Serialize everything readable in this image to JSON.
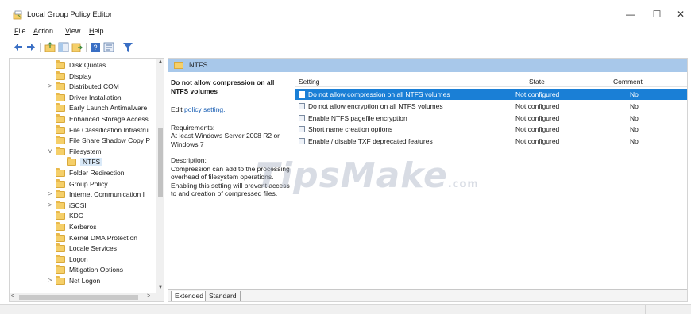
{
  "window": {
    "title": "Local Group Policy Editor",
    "controls": {
      "minimize": "—",
      "maximize": "☐",
      "close": "✕"
    }
  },
  "menu": [
    "File",
    "Action",
    "View",
    "Help"
  ],
  "toolbar": {
    "icons": [
      "back-arrow-icon",
      "forward-arrow-icon",
      "up-folder-icon",
      "show-hide-tree-icon",
      "export-list-icon",
      "help-icon",
      "properties-icon",
      "filter-icon"
    ]
  },
  "tree": {
    "items": [
      {
        "label": "Disk Quotas",
        "indent": 1,
        "expander": ""
      },
      {
        "label": "Display",
        "indent": 1,
        "expander": ""
      },
      {
        "label": "Distributed COM",
        "indent": 1,
        "expander": ">"
      },
      {
        "label": "Driver Installation",
        "indent": 1,
        "expander": ""
      },
      {
        "label": "Early Launch Antimalware",
        "indent": 1,
        "expander": ""
      },
      {
        "label": "Enhanced Storage Access",
        "indent": 1,
        "expander": ""
      },
      {
        "label": "File Classification Infrastru",
        "indent": 1,
        "expander": ""
      },
      {
        "label": "File Share Shadow Copy P",
        "indent": 1,
        "expander": ""
      },
      {
        "label": "Filesystem",
        "indent": 1,
        "expander": "v"
      },
      {
        "label": "NTFS",
        "indent": 2,
        "expander": "",
        "selected": true
      },
      {
        "label": "Folder Redirection",
        "indent": 1,
        "expander": ""
      },
      {
        "label": "Group Policy",
        "indent": 1,
        "expander": ""
      },
      {
        "label": "Internet Communication I",
        "indent": 1,
        "expander": ">"
      },
      {
        "label": "iSCSI",
        "indent": 1,
        "expander": ">"
      },
      {
        "label": "KDC",
        "indent": 1,
        "expander": ""
      },
      {
        "label": "Kerberos",
        "indent": 1,
        "expander": ""
      },
      {
        "label": "Kernel DMA Protection",
        "indent": 1,
        "expander": ""
      },
      {
        "label": "Locale Services",
        "indent": 1,
        "expander": ""
      },
      {
        "label": "Logon",
        "indent": 1,
        "expander": ""
      },
      {
        "label": "Mitigation Options",
        "indent": 1,
        "expander": ""
      },
      {
        "label": "Net Logon",
        "indent": 1,
        "expander": ">"
      }
    ]
  },
  "panel": {
    "header": "NTFS",
    "description": {
      "heading": "Do not allow compression on all NTFS volumes",
      "edit_prefix": "Edit ",
      "edit_link": "policy setting.",
      "requirements_label": "Requirements:",
      "requirements_text": "At least Windows Server 2008 R2 or Windows 7",
      "description_label": "Description:",
      "description_text": "Compression can add to the processing overhead of filesystem operations. Enabling this setting will prevent access to and creation of compressed files."
    },
    "columns": {
      "setting": "Setting",
      "state": "State",
      "comment": "Comment"
    },
    "settings": [
      {
        "name": "Do not allow compression on all NTFS volumes",
        "state": "Not configured",
        "comment": "No",
        "selected": true
      },
      {
        "name": "Do not allow encryption on all NTFS volumes",
        "state": "Not configured",
        "comment": "No"
      },
      {
        "name": "Enable NTFS pagefile encryption",
        "state": "Not configured",
        "comment": "No"
      },
      {
        "name": "Short name creation options",
        "state": "Not configured",
        "comment": "No"
      },
      {
        "name": "Enable / disable TXF deprecated features",
        "state": "Not configured",
        "comment": "No"
      }
    ],
    "tabs": [
      "Extended",
      "Standard"
    ],
    "watermark": {
      "main": "TipsMake",
      "suffix": ".com"
    }
  },
  "colors": {
    "selection": "#1a7fd6",
    "header": "#a8c8ea",
    "folder": "#f5cf69"
  }
}
